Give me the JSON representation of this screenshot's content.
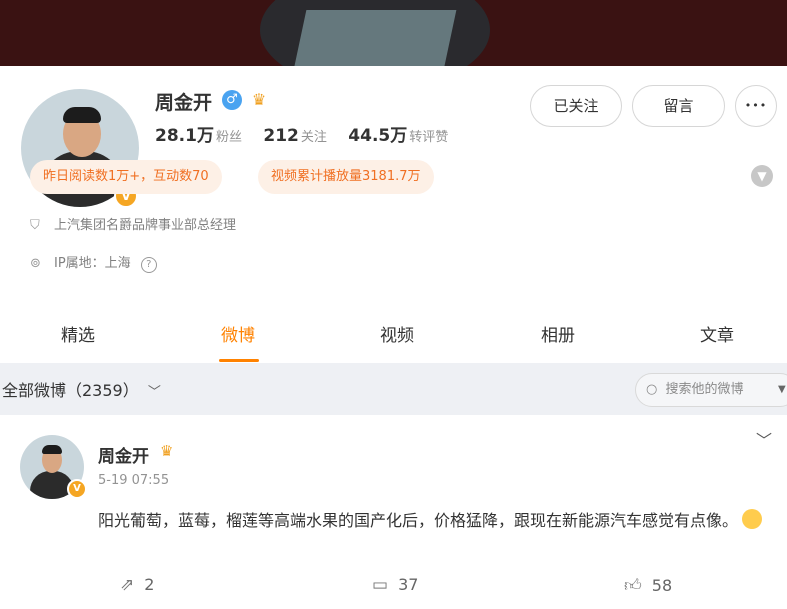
{
  "profile": {
    "name": "周金开",
    "followers_value": "28.1万",
    "followers_label": "粉丝",
    "following_value": "212",
    "following_label": "关注",
    "likes_value": "44.5万",
    "likes_label": "转评赞",
    "followed_button": "已关注",
    "message_button": "留言",
    "more_button": "•••",
    "tag_reads": "昨日阅读数1万+，互动数70",
    "tag_video": "视频累计播放量3181.7万",
    "cert": "上汽集团名爵品牌事业部总经理",
    "ip": "IP属地：上海"
  },
  "tabs": [
    "精选",
    "微博",
    "视频",
    "相册",
    "文章"
  ],
  "filter": {
    "label": "全部微博（2359）",
    "search_placeholder": "搜索他的微博"
  },
  "post": {
    "author": "周金开",
    "time": "5-19 07:55",
    "text": "阳光葡萄，蓝莓，榴莲等高端水果的国产化后，价格猛降，跟现在新能源汽车感觉有点像。",
    "reposts": "2",
    "comments": "37",
    "likes": "58"
  },
  "colors": {
    "accent": "#ff8200",
    "tag_text": "#f06f22",
    "tag_bg": "#fdf0e6",
    "verified": "#f5a623",
    "male": "#4aa3f0"
  },
  "icons": [
    "male-icon",
    "crown-icon",
    "verified-icon",
    "shield-icon",
    "location-icon",
    "help-icon",
    "search-icon",
    "chevron-down-icon",
    "repost-icon",
    "comment-icon",
    "like-icon"
  ]
}
